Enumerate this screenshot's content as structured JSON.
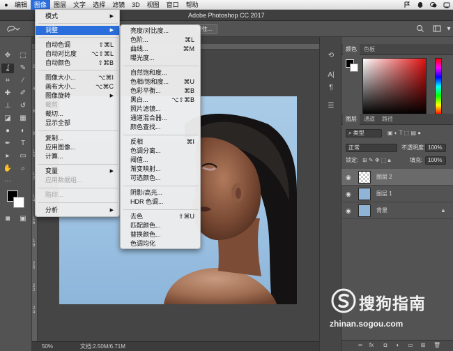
{
  "menubar": {
    "items": [
      "编辑",
      "图像",
      "图层",
      "文字",
      "选择",
      "滤镜",
      "3D",
      "视图",
      "窗口",
      "帮助"
    ],
    "active": "图像"
  },
  "window": {
    "title": "Adobe Photoshop CC 2017"
  },
  "options": {
    "button_fragment": "缝住..."
  },
  "image_menu": {
    "mode": "模式",
    "adjust": "调整",
    "auto_tone": "自动色调",
    "auto_tone_sc": "⇧⌘L",
    "auto_contrast": "自动对比度",
    "auto_contrast_sc": "⌥⇧⌘L",
    "auto_color": "自动颜色",
    "auto_color_sc": "⇧⌘B",
    "image_size": "图像大小...",
    "image_size_sc": "⌥⌘I",
    "canvas_size": "画布大小...",
    "canvas_size_sc": "⌥⌘C",
    "rotation": "图像旋转",
    "crop": "裁剪",
    "trim": "裁切...",
    "reveal_all": "显示全部",
    "duplicate": "复制...",
    "apply_image": "应用图像...",
    "calculations": "计算...",
    "variables": "变量",
    "apply_dataset": "应用数据组...",
    "trap": "陷印...",
    "analysis": "分析"
  },
  "adjust_menu": {
    "brightness": "亮度/对比度...",
    "levels": "色阶...",
    "levels_sc": "⌘L",
    "curves": "曲线...",
    "curves_sc": "⌘M",
    "exposure": "曝光度...",
    "vibrance": "自然饱和度...",
    "hue_sat": "色相/饱和度...",
    "hue_sat_sc": "⌘U",
    "color_balance": "色彩平衡...",
    "color_balance_sc": "⌘B",
    "bw": "黑白...",
    "bw_sc": "⌥⇧⌘B",
    "photo_filter": "照片滤镜...",
    "channel_mixer": "通道混合器...",
    "color_lookup": "颜色查找...",
    "invert": "反相",
    "invert_sc": "⌘I",
    "posterize": "色调分离...",
    "threshold": "阈值...",
    "gradient_map": "渐变映射...",
    "selective_color": "可选颜色...",
    "shadows_highlights": "阴影/高光...",
    "hdr_toning": "HDR 色调...",
    "desaturate": "去色",
    "desaturate_sc": "⇧⌘U",
    "match_color": "匹配颜色...",
    "replace_color": "替换颜色...",
    "equalize": "色调均化"
  },
  "color_panel": {
    "tab_color": "颜色",
    "tab_swatches": "色板"
  },
  "layers_panel": {
    "tab_layers": "图层",
    "tab_channels": "通道",
    "tab_paths": "路径",
    "kind": "类型",
    "blend_mode": "正常",
    "opacity_label": "不透明度:",
    "opacity_value": "100%",
    "lock_label": "锁定:",
    "fill_label": "填充:",
    "fill_value": "100%",
    "layers": [
      "图层 2",
      "图层 1",
      "背景"
    ]
  },
  "status": {
    "zoom": "50%",
    "doc": "文档:2.50M/6.71M"
  },
  "ruler_ticks": [
    "2",
    "4",
    "6",
    "8",
    "1 0",
    "1 2",
    "1 4",
    "1 6",
    "1 8",
    "2 0",
    "2 2",
    "2 4"
  ],
  "watermark": {
    "brand": "搜狗指南",
    "url": "zhinan.sogou.com"
  },
  "colors": {
    "accent": "#2a6edb",
    "panel_bg": "#535353",
    "canvas_bg": "#454545"
  }
}
